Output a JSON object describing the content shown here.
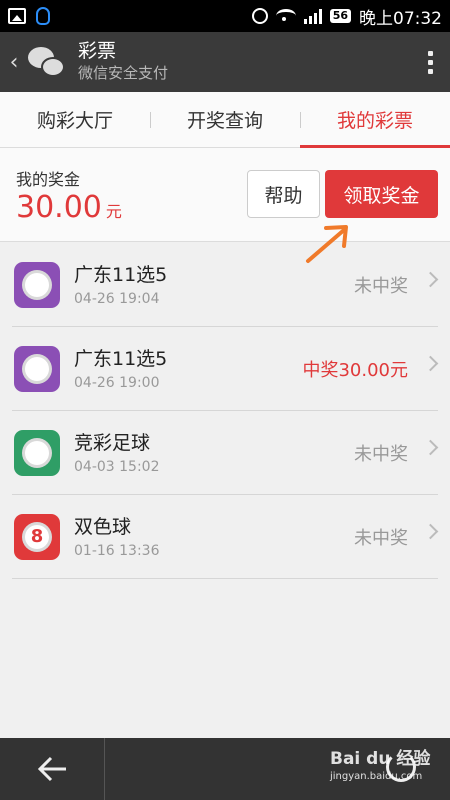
{
  "status_bar": {
    "battery": "56",
    "time": "晚上07:32"
  },
  "title_bar": {
    "title": "彩票",
    "subtitle": "微信安全支付"
  },
  "tabs": [
    {
      "label": "购彩大厅"
    },
    {
      "label": "开奖查询"
    },
    {
      "label": "我的彩票"
    }
  ],
  "prize": {
    "label": "我的奖金",
    "amount": "30.00",
    "unit": "元",
    "help_label": "帮助",
    "claim_label": "领取奖金"
  },
  "tickets": [
    {
      "icon": "lottery-11x5-icon",
      "name": "广东11选5",
      "time": "04-26 19:04",
      "status": "未中奖"
    },
    {
      "icon": "lottery-11x5-icon",
      "name": "广东11选5",
      "time": "04-26 19:00",
      "status": "中奖30.00元"
    },
    {
      "icon": "soccer-ball-icon",
      "name": "竞彩足球",
      "time": "04-03 15:02",
      "status": "未中奖"
    },
    {
      "icon": "billiard-ball-8-icon",
      "name": "双色球",
      "time": "01-16 13:36",
      "status": "未中奖"
    }
  ],
  "watermark": {
    "main": "Bai du 经验",
    "sub": "jingyan.baidu.com"
  },
  "colors": {
    "accent": "#e0393a",
    "title_bar": "#3a3a3a",
    "purple_icon": "#8b4fb5",
    "green_icon": "#2f9e66"
  }
}
